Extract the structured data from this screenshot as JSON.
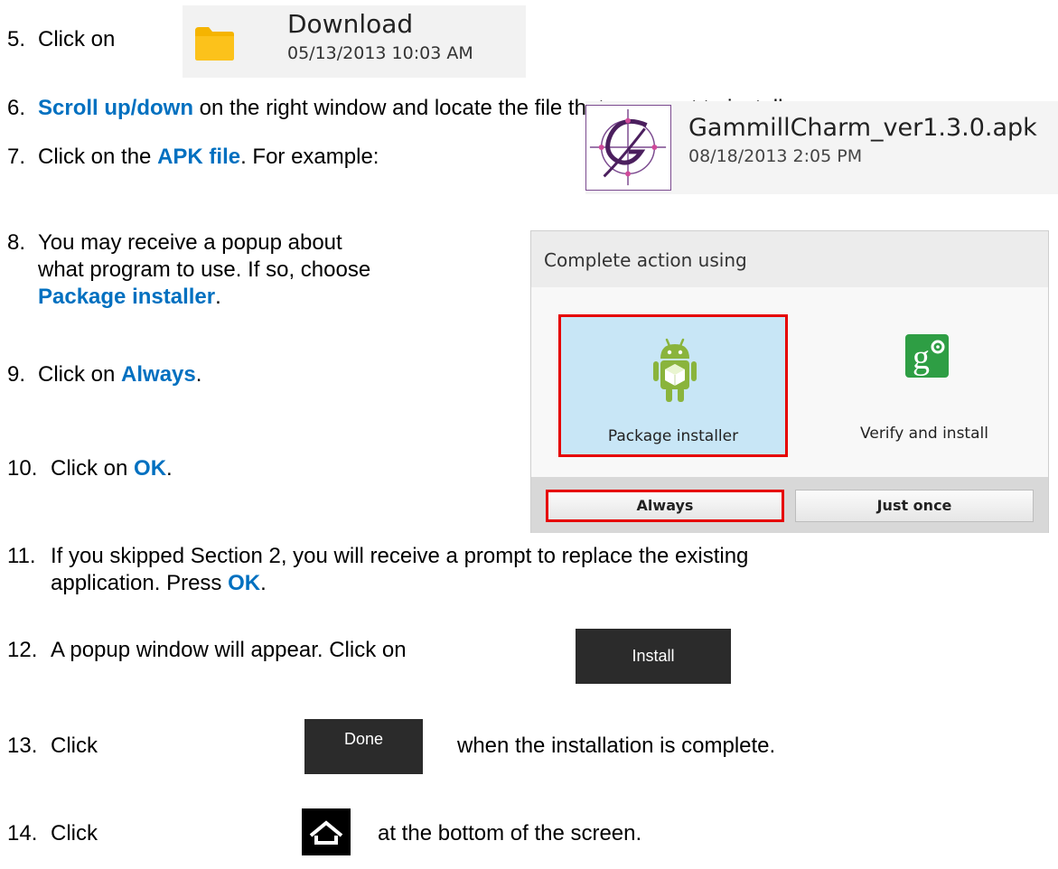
{
  "steps": {
    "s5": {
      "num": "5.",
      "text": "Click on"
    },
    "s6": {
      "num": "6.",
      "highlight": "Scroll up/down",
      "rest": " on the right window and locate the file that you want to install."
    },
    "s7": {
      "num": "7.",
      "pre": "Click on the ",
      "highlight": "APK file",
      "post": ".  For example:"
    },
    "s8": {
      "num": "8.",
      "line1": "You may receive a popup about",
      "line2": "what program to use.  If so, choose",
      "highlight": "Package installer",
      "post": "."
    },
    "s9": {
      "num": "9.",
      "pre": "Click on ",
      "highlight": "Always",
      "post": "."
    },
    "s10": {
      "num": "10.",
      "pre": "Click on ",
      "highlight": "OK",
      "post": "."
    },
    "s11": {
      "num": "11.",
      "line1": "If you skipped Section 2, you will receive a prompt to replace the existing",
      "line2": "application.  Press ",
      "highlight": "OK",
      "post": "."
    },
    "s12": {
      "num": "12.",
      "text": "A popup window will appear.  Click on"
    },
    "s13": {
      "num": "13.",
      "pre": "Click",
      "post": "when the installation is complete."
    },
    "s14": {
      "num": "14.",
      "pre": "Click",
      "post": "at the bottom of the screen."
    }
  },
  "download_item": {
    "name": "Download",
    "date": "05/13/2013 10:03 AM",
    "icon": "folder-icon",
    "color": "#f5b400"
  },
  "apk_item": {
    "name": "GammillCharm_ver1.3.0.apk",
    "date": "08/18/2013 2:05 PM",
    "icon": "gammill-logo"
  },
  "dialog": {
    "title": "Complete action using",
    "options": [
      {
        "label": "Package installer",
        "icon": "android-package-icon",
        "selected": true
      },
      {
        "label": "Verify and install",
        "icon": "google-verify-icon",
        "selected": false
      }
    ],
    "buttons": {
      "always": "Always",
      "once": "Just once"
    }
  },
  "buttons": {
    "install": "Install",
    "done": "Done",
    "home_icon": "home-icon"
  },
  "colors": {
    "highlight": "#0070c0",
    "selection_border": "#e60000",
    "selection_fill": "#c8e6f6"
  }
}
